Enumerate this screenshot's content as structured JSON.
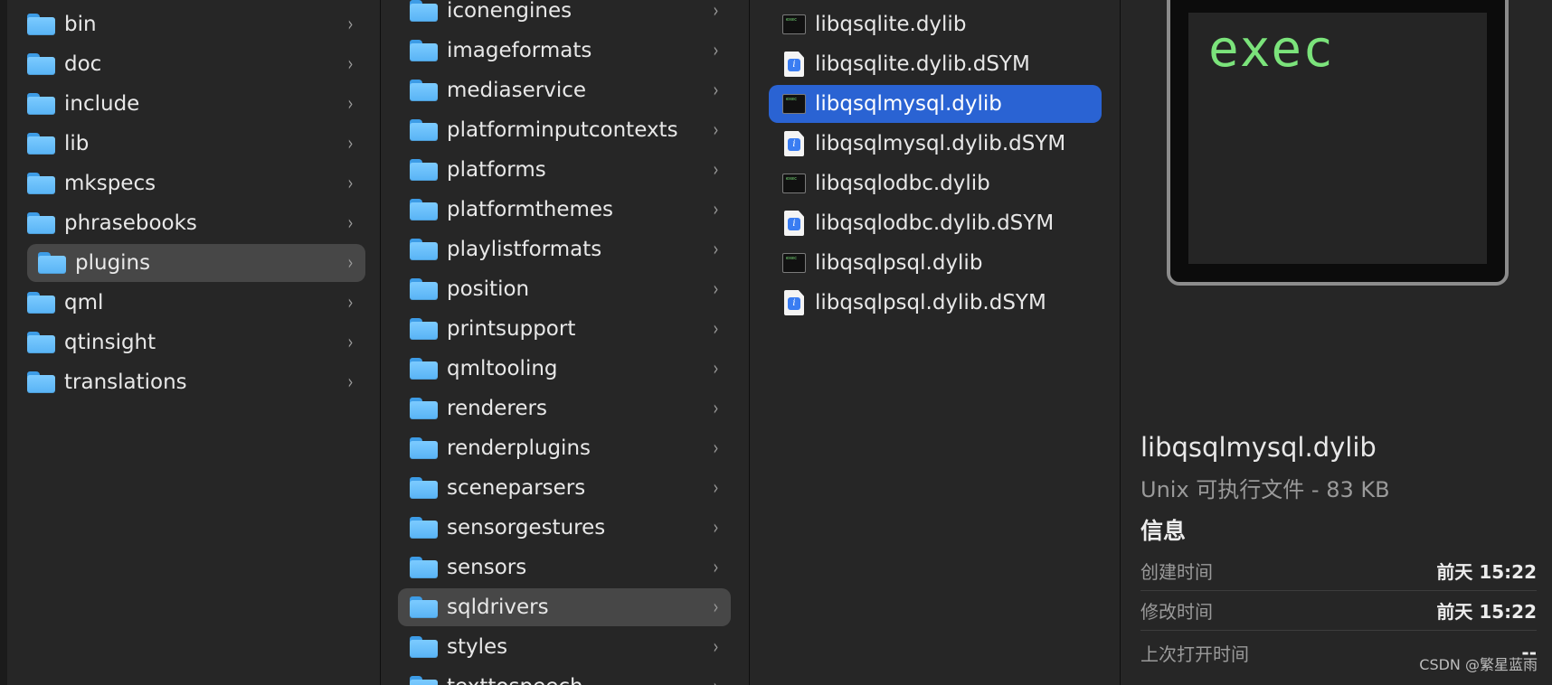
{
  "column1": {
    "items": [
      {
        "label": "bin"
      },
      {
        "label": "doc"
      },
      {
        "label": "include"
      },
      {
        "label": "lib"
      },
      {
        "label": "mkspecs"
      },
      {
        "label": "phrasebooks"
      },
      {
        "label": "plugins"
      },
      {
        "label": "qml"
      },
      {
        "label": "qtinsight"
      },
      {
        "label": "translations"
      }
    ],
    "selected": "plugins"
  },
  "column2": {
    "items": [
      {
        "label": "iconengines"
      },
      {
        "label": "imageformats"
      },
      {
        "label": "mediaservice"
      },
      {
        "label": "platforminputcontexts"
      },
      {
        "label": "platforms"
      },
      {
        "label": "platformthemes"
      },
      {
        "label": "playlistformats"
      },
      {
        "label": "position"
      },
      {
        "label": "printsupport"
      },
      {
        "label": "qmltooling"
      },
      {
        "label": "renderers"
      },
      {
        "label": "renderplugins"
      },
      {
        "label": "sceneparsers"
      },
      {
        "label": "sensorgestures"
      },
      {
        "label": "sensors"
      },
      {
        "label": "sqldrivers"
      },
      {
        "label": "styles"
      },
      {
        "label": "texttospeech"
      }
    ],
    "selected": "sqldrivers"
  },
  "column3": {
    "items": [
      {
        "label": "libqsqlite.dylib",
        "icon": "exec-file-icon"
      },
      {
        "label": "libqsqlite.dylib.dSYM",
        "icon": "dsym-file-icon"
      },
      {
        "label": "libqsqlmysql.dylib",
        "icon": "exec-file-icon"
      },
      {
        "label": "libqsqlmysql.dylib.dSYM",
        "icon": "dsym-file-icon"
      },
      {
        "label": "libqsqlodbc.dylib",
        "icon": "exec-file-icon"
      },
      {
        "label": "libqsqlodbc.dylib.dSYM",
        "icon": "dsym-file-icon"
      },
      {
        "label": "libqsqlpsql.dylib",
        "icon": "exec-file-icon"
      },
      {
        "label": "libqsqlpsql.dylib.dSYM",
        "icon": "dsym-file-icon"
      }
    ],
    "selected": "libqsqlmysql.dylib"
  },
  "preview": {
    "thumbnail_text": "exec",
    "file_name": "libqsqlmysql.dylib",
    "file_kind": "Unix 可执行文件 - 83 KB",
    "section_title": "信息",
    "info": [
      {
        "key": "创建时间",
        "value": "前天 15:22"
      },
      {
        "key": "修改时间",
        "value": "前天 15:22"
      },
      {
        "key": "上次打开时间",
        "value": "--"
      }
    ]
  },
  "watermark": "CSDN @繁星蓝雨",
  "colors": {
    "background": "#262626",
    "selection_blue": "#2a63d3",
    "selection_gray": "#474747",
    "folder": "#6cc0fb",
    "exec_green": "#7be37b"
  },
  "chevron_glyph": "›"
}
